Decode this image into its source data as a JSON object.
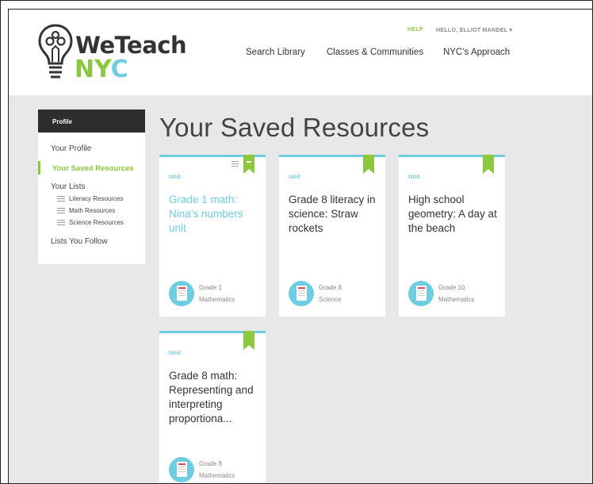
{
  "header": {
    "logo_line1": "WeTeach",
    "logo_n": "N",
    "logo_y": "Y",
    "logo_c": "C",
    "help": "HELP",
    "greeting": "HELLO, ELLIOT MANDEL ▾",
    "nav": [
      "Search Library",
      "Classes & Communities",
      "NYC’s Approach"
    ]
  },
  "sidebar": {
    "heading": "Profile",
    "items": [
      "Your Profile",
      "Your Saved Resources",
      "Your Lists",
      "Lists You Follow"
    ],
    "lists": [
      "Literacy Resources",
      "Math Resources",
      "Science Resources"
    ]
  },
  "page": {
    "title": "Your Saved Resources"
  },
  "cards": [
    {
      "type": "Unit",
      "title": "Grade 1 math: Nina’s numbers unit",
      "grade": "Grade 1",
      "subject": "Mathematics"
    },
    {
      "type": "Unit",
      "title": "Grade 8 literacy in science: Straw rockets",
      "grade": "Grade 8",
      "subject": "Science"
    },
    {
      "type": "Unit",
      "title": "High school geometry: A day at the beach",
      "grade": "Grade 10",
      "subject": "Mathematics"
    },
    {
      "type": "Unit",
      "title": "Grade 8 math: Representing and interpreting proportiona...",
      "grade": "Grade 8",
      "subject": "Mathematics"
    }
  ],
  "colors": {
    "accent_green": "#8dc63f",
    "accent_blue": "#6ecde0",
    "dark": "#2d2d2d",
    "bg": "#e8e8e8"
  },
  "icons": [
    "lightbulb-logo-icon",
    "list-icon",
    "bookmark-icon",
    "document-icon"
  ]
}
